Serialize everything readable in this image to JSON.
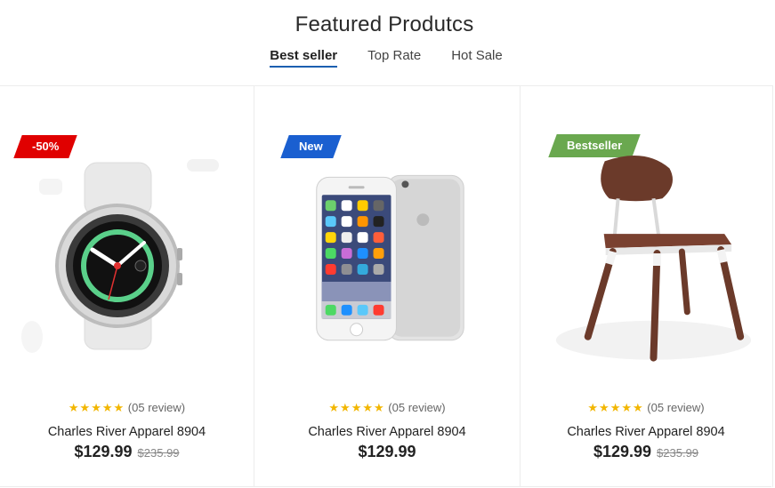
{
  "section": {
    "title": "Featured Produtcs"
  },
  "tabs": [
    {
      "label": "Best seller",
      "active": true
    },
    {
      "label": "Top Rate",
      "active": false
    },
    {
      "label": "Hot Sale",
      "active": false
    }
  ],
  "products": [
    {
      "badge": "-50%",
      "badge_color": "#e00000",
      "stars": "★★★★★",
      "review_text": "(05 review)",
      "name": "Charles River Apparel 8904",
      "price": "$129.99",
      "old_price": "$235.99"
    },
    {
      "badge": "New",
      "badge_color": "#1a5fd0",
      "stars": "★★★★★",
      "review_text": "(05 review)",
      "name": "Charles River Apparel 8904",
      "price": "$129.99",
      "old_price": ""
    },
    {
      "badge": "Bestseller",
      "badge_color": "#6aa84f",
      "stars": "★★★★★",
      "review_text": "(05 review)",
      "name": "Charles River Apparel 8904",
      "price": "$129.99",
      "old_price": "$235.99"
    }
  ]
}
